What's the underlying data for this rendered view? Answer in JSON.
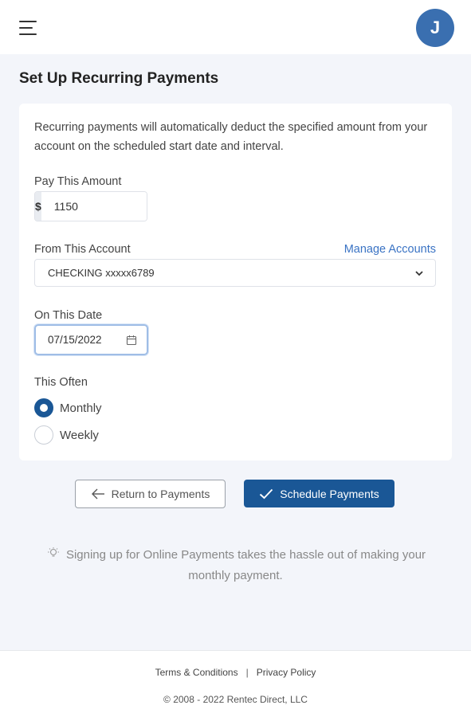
{
  "header": {
    "avatar_initial": "J"
  },
  "page": {
    "title": "Set Up Recurring Payments"
  },
  "form": {
    "description": "Recurring payments will automatically deduct the specified amount from your account on the scheduled start date and interval.",
    "amount_label": "Pay This Amount",
    "amount_prefix": "$",
    "amount_value": "1150",
    "account_label": "From This Account",
    "manage_accounts_link": "Manage Accounts",
    "account_selected": "CHECKING xxxxx6789",
    "date_label": "On This Date",
    "date_value": "07/15/2022",
    "frequency_label": "This Often",
    "frequency_options": [
      {
        "label": "Monthly",
        "checked": true
      },
      {
        "label": "Weekly",
        "checked": false
      }
    ]
  },
  "actions": {
    "return_label": "Return to Payments",
    "schedule_label": "Schedule Payments"
  },
  "tip": {
    "text": "Signing up for Online Payments takes the hassle out of making your monthly payment."
  },
  "footer": {
    "terms_link": "Terms & Conditions",
    "separator": "|",
    "privacy_link": "Privacy Policy",
    "copyright": "© 2008 - 2022 Rentec Direct, LLC"
  },
  "colors": {
    "primary": "#1a5796",
    "avatar": "#3a6fb0",
    "link": "#3a73c4",
    "background": "#f3f5fa"
  }
}
